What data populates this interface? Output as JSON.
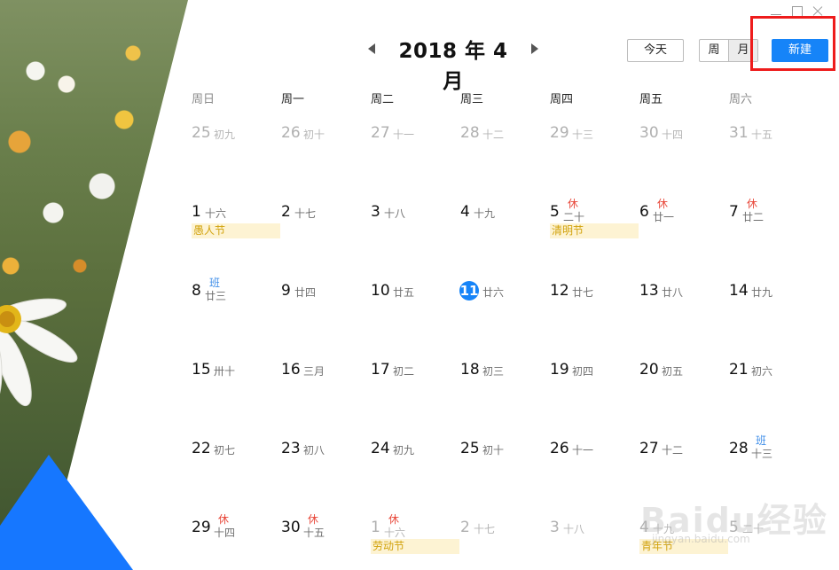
{
  "header": {
    "title": "2018 年 4 月",
    "today_label": "今天",
    "view_week": "周",
    "view_month": "月",
    "new_label": "新建"
  },
  "weekdays": [
    "周日",
    "周一",
    "周二",
    "周三",
    "周四",
    "周五",
    "周六"
  ],
  "weeks": [
    [
      {
        "day": "25",
        "lunar": "初九",
        "muted": true
      },
      {
        "day": "26",
        "lunar": "初十",
        "muted": true
      },
      {
        "day": "27",
        "lunar": "十一",
        "muted": true
      },
      {
        "day": "28",
        "lunar": "十二",
        "muted": true
      },
      {
        "day": "29",
        "lunar": "十三",
        "muted": true
      },
      {
        "day": "30",
        "lunar": "十四",
        "muted": true
      },
      {
        "day": "31",
        "lunar": "十五",
        "muted": true
      }
    ],
    [
      {
        "day": "1",
        "lunar": "十六",
        "holiday": "愚人节"
      },
      {
        "day": "2",
        "lunar": "十七"
      },
      {
        "day": "3",
        "lunar": "十八"
      },
      {
        "day": "4",
        "lunar": "十九"
      },
      {
        "day": "5",
        "lunar": "二十",
        "mark": "休",
        "holiday": "清明节"
      },
      {
        "day": "6",
        "lunar": "廿一",
        "mark": "休"
      },
      {
        "day": "7",
        "lunar": "廿二",
        "mark": "休"
      }
    ],
    [
      {
        "day": "8",
        "lunar": "廿三",
        "mark": "班"
      },
      {
        "day": "9",
        "lunar": "廿四"
      },
      {
        "day": "10",
        "lunar": "廿五"
      },
      {
        "day": "11",
        "lunar": "廿六",
        "today": true
      },
      {
        "day": "12",
        "lunar": "廿七"
      },
      {
        "day": "13",
        "lunar": "廿八"
      },
      {
        "day": "14",
        "lunar": "廿九"
      }
    ],
    [
      {
        "day": "15",
        "lunar": "卅十"
      },
      {
        "day": "16",
        "lunar": "三月"
      },
      {
        "day": "17",
        "lunar": "初二"
      },
      {
        "day": "18",
        "lunar": "初三"
      },
      {
        "day": "19",
        "lunar": "初四"
      },
      {
        "day": "20",
        "lunar": "初五"
      },
      {
        "day": "21",
        "lunar": "初六"
      }
    ],
    [
      {
        "day": "22",
        "lunar": "初七"
      },
      {
        "day": "23",
        "lunar": "初八"
      },
      {
        "day": "24",
        "lunar": "初九"
      },
      {
        "day": "25",
        "lunar": "初十"
      },
      {
        "day": "26",
        "lunar": "十一"
      },
      {
        "day": "27",
        "lunar": "十二"
      },
      {
        "day": "28",
        "lunar": "十三",
        "mark": "班"
      }
    ],
    [
      {
        "day": "29",
        "lunar": "十四",
        "mark": "休"
      },
      {
        "day": "30",
        "lunar": "十五",
        "mark": "休"
      },
      {
        "day": "1",
        "lunar": "十六",
        "mark": "休",
        "muted": true,
        "holiday": "劳动节"
      },
      {
        "day": "2",
        "lunar": "十七",
        "muted": true
      },
      {
        "day": "3",
        "lunar": "十八",
        "muted": true
      },
      {
        "day": "4",
        "lunar": "十九",
        "muted": true,
        "holiday": "青年节"
      },
      {
        "day": "5",
        "lunar": "二十",
        "muted": true
      }
    ]
  ],
  "watermark": {
    "logo": "Baidu经验",
    "url": "jingyan.baidu.com"
  },
  "colors": {
    "accent": "#1684f8",
    "rest": "#e8483a",
    "work": "#3f8ee8",
    "holiday_bg": "#fdf3d3",
    "holiday_text": "#d1a20b",
    "highlight": "#ee1c1c"
  }
}
